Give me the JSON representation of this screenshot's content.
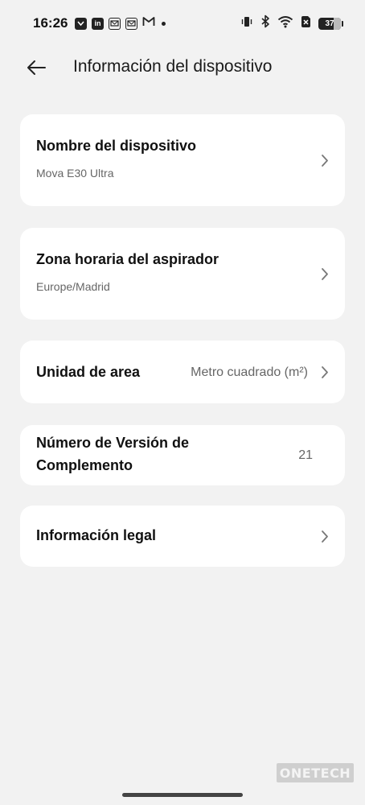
{
  "status_bar": {
    "time": "16:26",
    "left_icons": [
      "notification-app-icon",
      "linkedin-icon",
      "message-icon",
      "message-icon",
      "gmail-icon",
      "more-dot-icon"
    ],
    "right_icons": [
      "vibrate-icon",
      "bluetooth-icon",
      "wifi-icon",
      "no-sim-icon"
    ],
    "battery": "37"
  },
  "header": {
    "title": "Información del dispositivo"
  },
  "items": [
    {
      "title": "Nombre del dispositivo",
      "subtitle": "Mova E30 Ultra",
      "has_chevron": true
    },
    {
      "title": "Zona horaria del aspirador",
      "subtitle": "Europe/Madrid",
      "has_chevron": true
    },
    {
      "title": "Unidad de area",
      "value": "Metro cuadrado (m²)",
      "has_chevron": true
    },
    {
      "title_line1": "Número de Versión de",
      "title_line2": "Complemento",
      "value": "21",
      "has_chevron": false
    },
    {
      "title": "Información legal",
      "has_chevron": true
    }
  ],
  "watermark": "ONETECH",
  "colors": {
    "background": "#f2f2f2",
    "card": "#ffffff",
    "text_primary": "#111111",
    "text_secondary": "#666666"
  }
}
